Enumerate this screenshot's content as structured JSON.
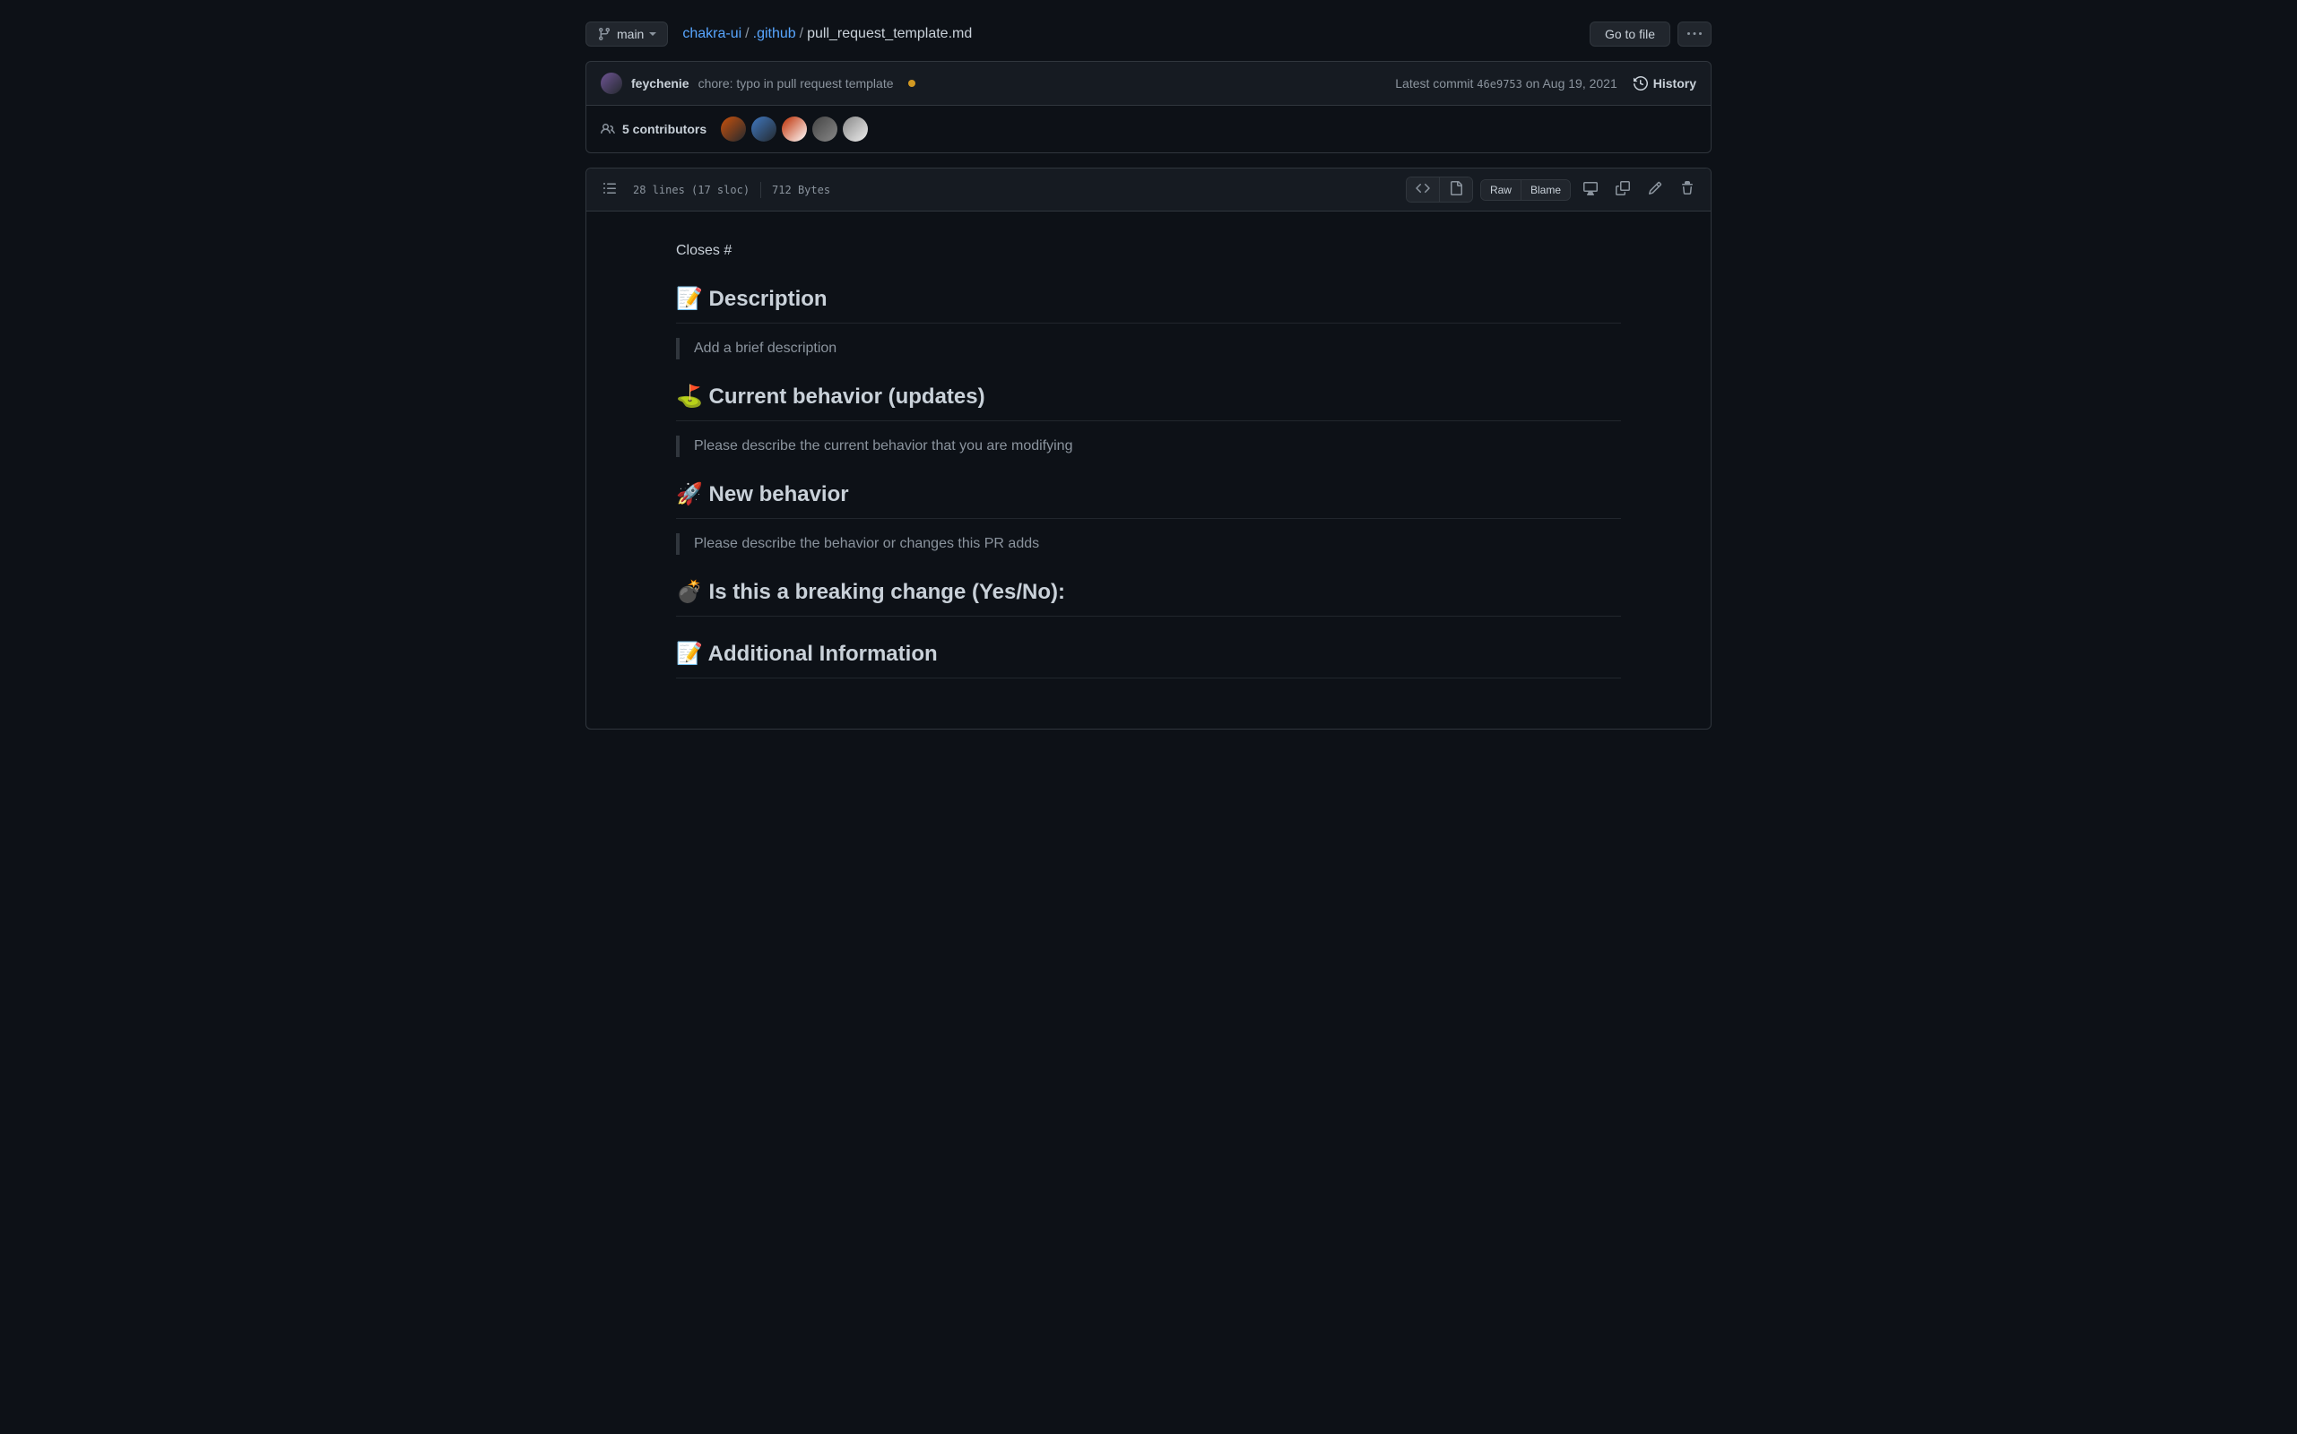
{
  "branch": {
    "name": "main"
  },
  "breadcrumb": {
    "repo": "chakra-ui",
    "folder": ".github",
    "file": "pull_request_template.md"
  },
  "actions": {
    "go_to_file": "Go to file"
  },
  "commit": {
    "author": "feychenie",
    "message": "chore: typo in pull request template",
    "latest_label": "Latest commit",
    "hash": "46e9753",
    "date": "on Aug 19, 2021",
    "history_label": "History"
  },
  "contributors": {
    "count_label": "5 contributors"
  },
  "file_meta": {
    "lines": "28 lines (17 sloc)",
    "size": "712 Bytes",
    "raw": "Raw",
    "blame": "Blame"
  },
  "markdown": {
    "closes": "Closes #",
    "h_description": "📝 Description",
    "bq_description": "Add a brief description",
    "h_current": "⛳️ Current behavior (updates)",
    "bq_current": "Please describe the current behavior that you are modifying",
    "h_new": "🚀 New behavior",
    "bq_new": "Please describe the behavior or changes this PR adds",
    "h_breaking": "💣 Is this a breaking change (Yes/No):",
    "h_additional": "📝 Additional Information"
  }
}
